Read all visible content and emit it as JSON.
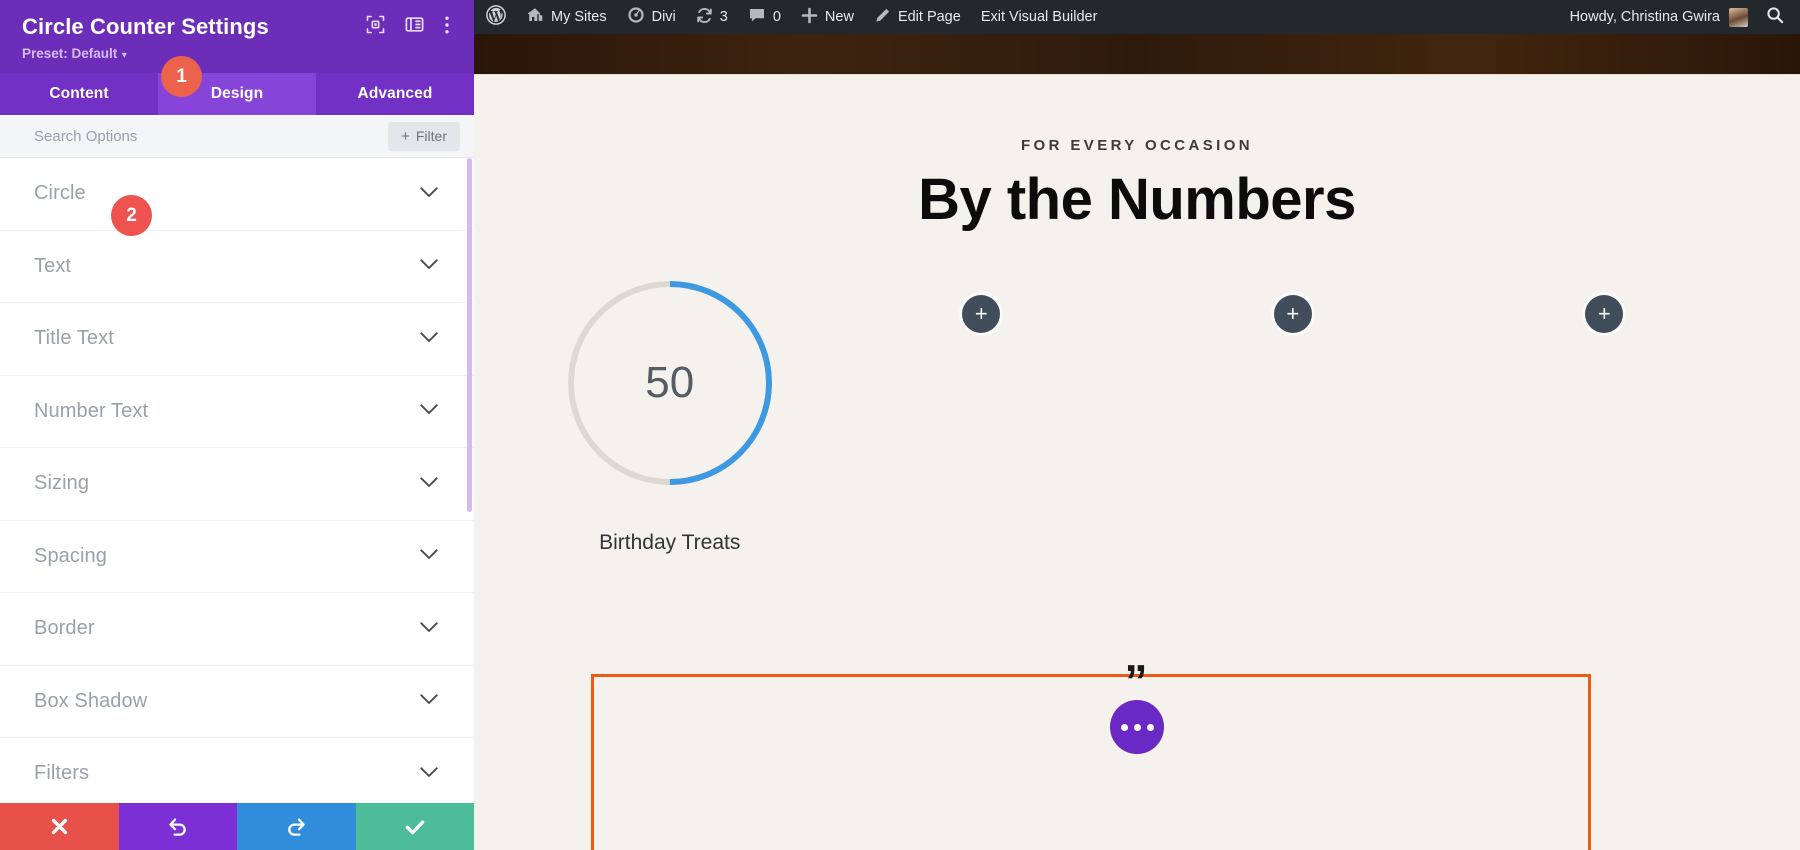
{
  "panel": {
    "title": "Circle Counter Settings",
    "preset_label": "Preset: Default",
    "preset_caret": "▾",
    "header_icons": [
      {
        "name": "focus-target-icon"
      },
      {
        "name": "panel-layout-icon"
      },
      {
        "name": "more-vertical-icon"
      }
    ],
    "tabs": [
      {
        "label": "Content",
        "active": false
      },
      {
        "label": "Design",
        "active": true
      },
      {
        "label": "Advanced",
        "active": false
      }
    ],
    "search": {
      "placeholder": "Search Options",
      "value": ""
    },
    "filter_button": {
      "label": "Filter",
      "plus": "+"
    },
    "sections": [
      {
        "label": "Circle"
      },
      {
        "label": "Text"
      },
      {
        "label": "Title Text"
      },
      {
        "label": "Number Text"
      },
      {
        "label": "Sizing"
      },
      {
        "label": "Spacing"
      },
      {
        "label": "Border"
      },
      {
        "label": "Box Shadow"
      },
      {
        "label": "Filters"
      }
    ],
    "actions": [
      {
        "name": "discard-button",
        "icon": "close-x-icon",
        "color": "#e8504a"
      },
      {
        "name": "undo-button",
        "icon": "undo-arrow-icon",
        "color": "#7b2fd4"
      },
      {
        "name": "redo-button",
        "icon": "redo-arrow-icon",
        "color": "#2f8ddb"
      },
      {
        "name": "save-button",
        "icon": "checkmark-icon",
        "color": "#4dbd99"
      }
    ],
    "badges": [
      {
        "number": "1",
        "target": "design-tab"
      },
      {
        "number": "2",
        "target": "circle-section"
      }
    ],
    "colors": {
      "header_purple": "#6c2eb9",
      "tab_bar_purple": "#7230c4",
      "tab_active_purple": "#8645d8",
      "badge_orange": "#ec624c",
      "badge_red": "#ef5350"
    }
  },
  "adminbar": {
    "items": [
      {
        "label": "",
        "icon": "wordpress-logo-icon",
        "name": "wp-logo"
      },
      {
        "label": "My Sites",
        "icon": "sites-icon",
        "name": "my-sites"
      },
      {
        "label": "Divi",
        "icon": "divi-gauge-icon",
        "name": "divi-menu"
      },
      {
        "label": "3",
        "icon": "updates-icon",
        "name": "updates"
      },
      {
        "label": "0",
        "icon": "comment-bubble-icon",
        "name": "comments"
      },
      {
        "label": "New",
        "icon": "plus-icon",
        "name": "new-content"
      },
      {
        "label": "Edit Page",
        "icon": "pencil-icon",
        "name": "edit-page"
      },
      {
        "label": "Exit Visual Builder",
        "icon": "",
        "name": "exit-visual-builder"
      }
    ],
    "howdy": "Howdy, Christina Gwira",
    "search_icon": "search-icon"
  },
  "canvas": {
    "eyebrow": "FOR EVERY OCCASION",
    "title": "By the Numbers",
    "counters": [
      {
        "number": "50",
        "label": "Birthday Treats",
        "percent": 50,
        "arc_color": "#3d9ae2",
        "track_color": "#dcd9d3"
      }
    ],
    "add_buttons": [
      {
        "label": "+",
        "name": "add-module-button-1"
      },
      {
        "label": "+",
        "name": "add-module-button-2"
      },
      {
        "label": "+",
        "name": "add-module-button-3"
      }
    ],
    "quote_mark": "”",
    "dots_button_label": "•••",
    "section_border_color": "#ec5b13",
    "background": "#f5f2ed"
  }
}
